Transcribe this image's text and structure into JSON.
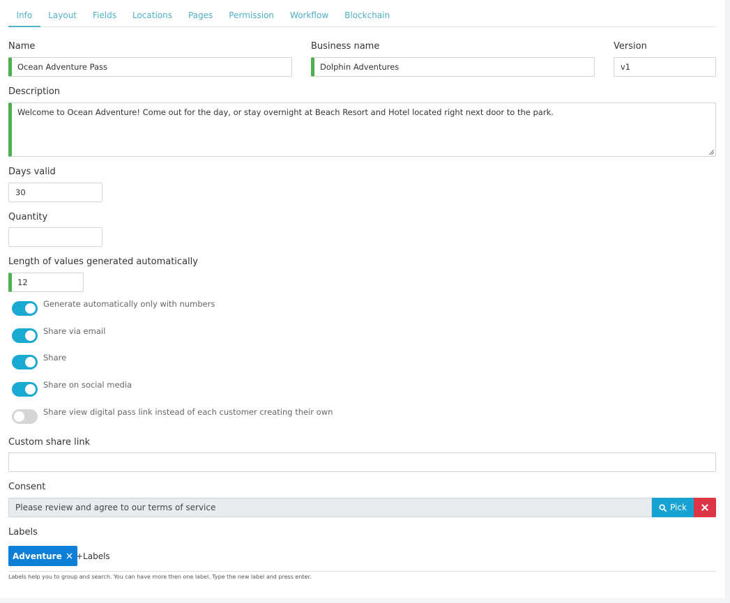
{
  "tabs": [
    "Info",
    "Layout",
    "Fields",
    "Locations",
    "Pages",
    "Permission",
    "Workflow",
    "Blockchain"
  ],
  "fields": {
    "name": {
      "label": "Name",
      "value": "Ocean Adventure Pass"
    },
    "business_name": {
      "label": "Business name",
      "value": "Dolphin Adventures"
    },
    "version": {
      "label": "Version",
      "value": "v1"
    },
    "description": {
      "label": "Description",
      "value": "Welcome to Ocean Adventure! Come out for the day, or stay overnight at Beach Resort and Hotel located right next door to the park."
    },
    "days_valid": {
      "label": "Days valid",
      "value": "30"
    },
    "quantity": {
      "label": "Quantity",
      "value": ""
    },
    "length": {
      "label": "Length of values generated automatically",
      "value": "12"
    },
    "custom_share_link": {
      "label": "Custom share link",
      "value": ""
    },
    "consent": {
      "label": "Consent",
      "value": "Please review and agree to our terms of service",
      "pick_label": "Pick"
    },
    "labels": {
      "label": "Labels",
      "chip": "Adventure",
      "add": "+Labels",
      "help": "Labels help you to group and search. You can have more then one label. Type the new label and press enter."
    }
  },
  "toggles": [
    {
      "label": "Generate automatically only with numbers",
      "on": true
    },
    {
      "label": "Share via email",
      "on": true
    },
    {
      "label": "Share",
      "on": true
    },
    {
      "label": "Share on social media",
      "on": true
    },
    {
      "label": "Share view digital pass link instead of each customer creating their own",
      "on": false
    }
  ],
  "colors": {
    "accent": "#1aa9d1",
    "valid": "#4caf50",
    "danger": "#dc3545",
    "chip": "#0d7fd6"
  },
  "icons": {
    "pick": "search-icon",
    "delete": "close-icon",
    "chip_remove": "close-icon"
  }
}
